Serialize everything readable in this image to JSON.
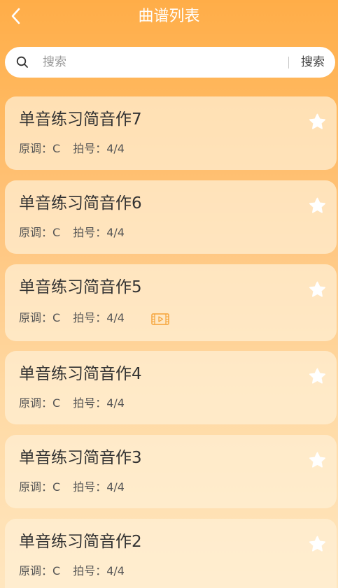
{
  "header": {
    "title": "曲谱列表"
  },
  "search": {
    "placeholder": "搜索",
    "button_label": "搜索"
  },
  "scores": [
    {
      "title": "单音练习简音作7",
      "key_label": "原调：",
      "key": "C",
      "beat_label": "拍号：",
      "beat": "4/4",
      "has_video": false,
      "favorited": false
    },
    {
      "title": "单音练习简音作6",
      "key_label": "原调：",
      "key": "C",
      "beat_label": "拍号：",
      "beat": "4/4",
      "has_video": false,
      "favorited": false
    },
    {
      "title": "单音练习简音作5",
      "key_label": "原调：",
      "key": "C",
      "beat_label": "拍号：",
      "beat": "4/4",
      "has_video": true,
      "favorited": false
    },
    {
      "title": "单音练习简音作4",
      "key_label": "原调：",
      "key": "C",
      "beat_label": "拍号：",
      "beat": "4/4",
      "has_video": false,
      "favorited": false
    },
    {
      "title": "单音练习简音作3",
      "key_label": "原调：",
      "key": "C",
      "beat_label": "拍号：",
      "beat": "4/4",
      "has_video": false,
      "favorited": false
    },
    {
      "title": "单音练习简音作2",
      "key_label": "原调：",
      "key": "C",
      "beat_label": "拍号：",
      "beat": "4/4",
      "has_video": false,
      "favorited": false
    }
  ],
  "colors": {
    "header_gradient_top": "#ffad48",
    "video_icon": "#f5a236",
    "star": "#ffffff"
  }
}
